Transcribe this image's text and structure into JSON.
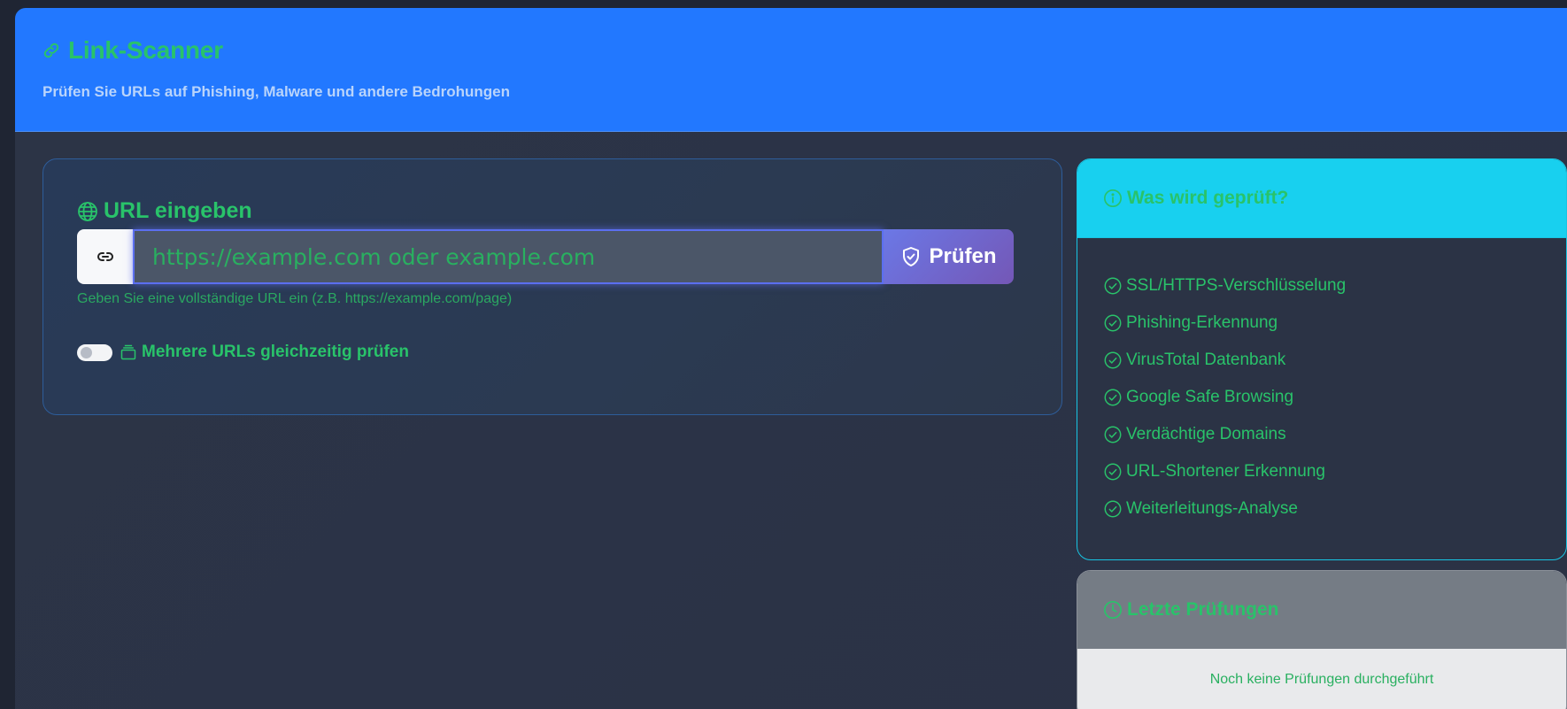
{
  "header": {
    "title": "Link-Scanner",
    "subtitle": "Prüfen Sie URLs auf Phishing, Malware und andere Bedrohungen",
    "icon": "link-icon"
  },
  "url_card": {
    "title": "URL eingeben",
    "title_icon": "globe-icon",
    "prefix_icon": "link-icon",
    "input_placeholder": "https://example.com oder example.com",
    "input_value": "",
    "button_label": "Prüfen",
    "button_icon": "shield-check-icon",
    "helper_text": "Geben Sie eine vollständige URL ein (z.B. https://example.com/page)",
    "multi_toggle_label": "Mehrere URLs gleichzeitig prüfen",
    "multi_toggle_on": false,
    "multi_icon": "stack-icon"
  },
  "info_card": {
    "title": "Was wird geprüft?",
    "title_icon": "info-icon",
    "items": [
      "SSL/HTTPS-Verschlüsselung",
      "Phishing-Erkennung",
      "VirusTotal Datenbank",
      "Google Safe Browsing",
      "Verdächtige Domains",
      "URL-Shortener Erkennung",
      "Weiterleitungs-Analyse"
    ],
    "item_icon": "check-circle-icon"
  },
  "recent_card": {
    "title": "Letzte Prüfungen",
    "title_icon": "clock-icon",
    "empty_text": "Noch keine Prüfungen durchgeführt"
  },
  "colors": {
    "accent_green": "#29c36a",
    "header_blue": "#2278ff",
    "info_cyan": "#18d0ef",
    "button_purple": "#6b78e6",
    "background": "#2b3345"
  }
}
